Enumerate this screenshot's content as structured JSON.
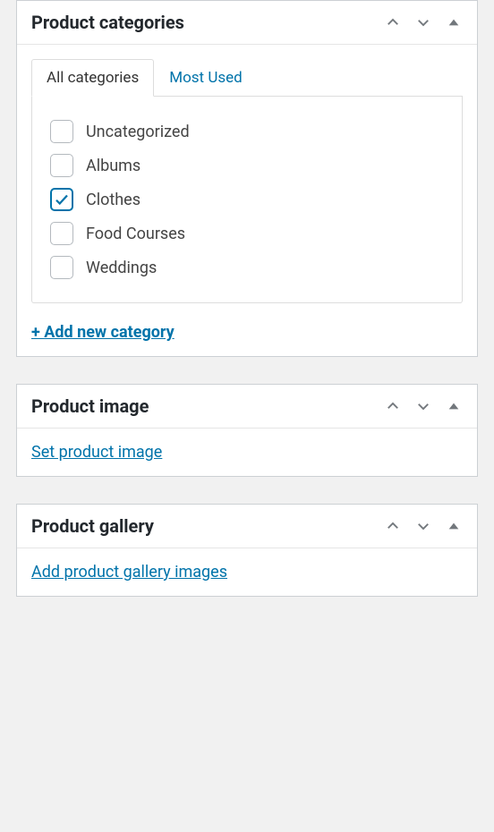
{
  "boxes": {
    "categories": {
      "title": "Product categories",
      "tabs": {
        "all": "All categories",
        "used": "Most Used"
      },
      "items": [
        {
          "label": "Uncategorized",
          "checked": false
        },
        {
          "label": "Albums",
          "checked": false
        },
        {
          "label": "Clothes",
          "checked": true
        },
        {
          "label": "Food Courses",
          "checked": false
        },
        {
          "label": "Weddings",
          "checked": false
        }
      ],
      "add_link": "+ Add new category"
    },
    "image": {
      "title": "Product image",
      "link": "Set product image"
    },
    "gallery": {
      "title": "Product gallery",
      "link": "Add product gallery images"
    }
  }
}
